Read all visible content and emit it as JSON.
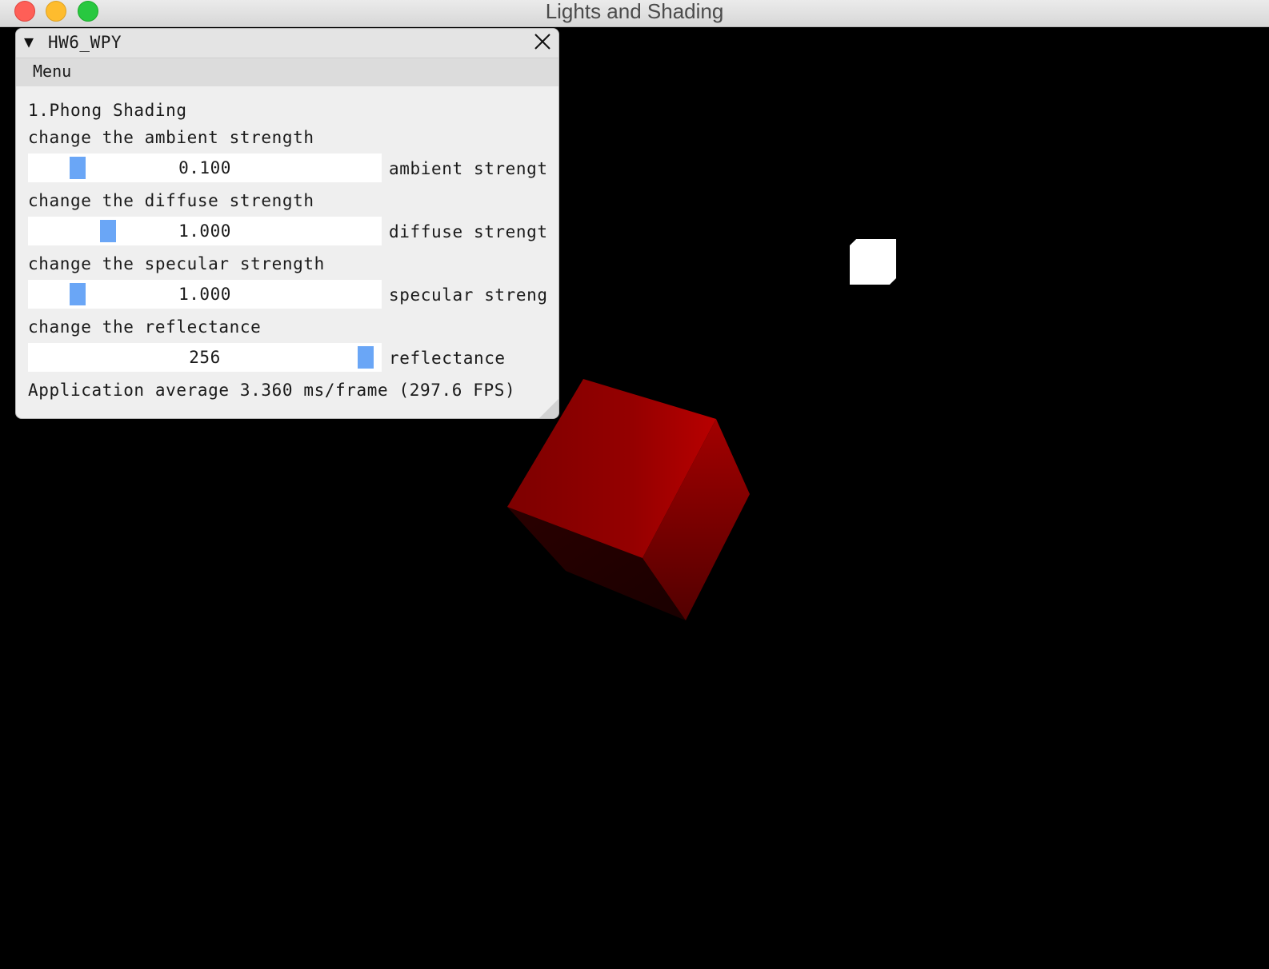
{
  "window": {
    "title": "Lights and Shading"
  },
  "panel": {
    "title": "HW6_WPY",
    "menu_label": "Menu",
    "section_title": "1.Phong Shading",
    "controls": [
      {
        "description": "change the ambient strength",
        "value_text": "0.100",
        "label": "ambient strengt",
        "slider_fraction": 0.12
      },
      {
        "description": "change the diffuse strength",
        "value_text": "1.000",
        "label": "diffuse strengt",
        "slider_fraction": 0.21
      },
      {
        "description": "change the specular strength",
        "value_text": "1.000",
        "label": "specular streng",
        "slider_fraction": 0.12
      },
      {
        "description": "change the reflectance",
        "value_text": "256",
        "label": "reflectance",
        "slider_fraction": 0.98
      }
    ],
    "fps_text": "Application average 3.360 ms/frame (297.6 FPS)"
  },
  "colors": {
    "slider_grab": "#6aa6f6",
    "cube_red": "#a30000",
    "background": "#000000"
  },
  "icons": {
    "collapse": "triangle-down-icon",
    "close": "close-icon"
  }
}
